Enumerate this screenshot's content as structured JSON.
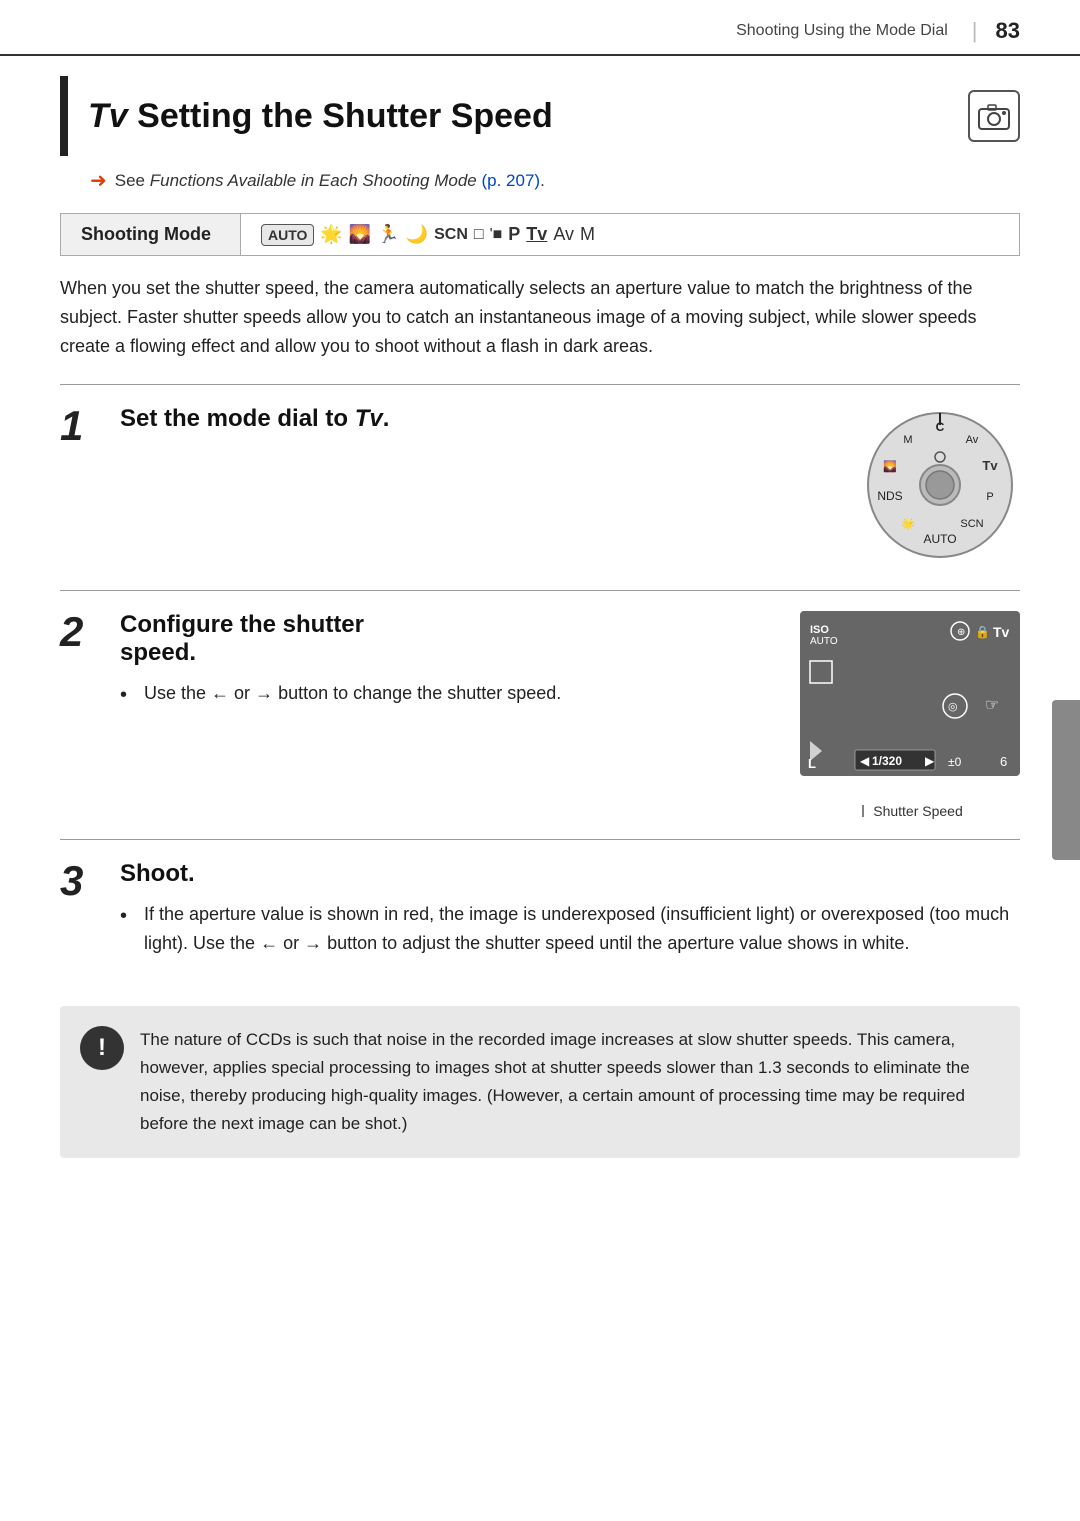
{
  "header": {
    "chapter_title": "Shooting Using the Mode Dial",
    "page_number": "83"
  },
  "title": {
    "prefix": "Tv",
    "main": "Setting the Shutter Speed",
    "camera_icon": "📷"
  },
  "see_ref": {
    "arrow": "➜",
    "text_before": "See ",
    "italic_text": "Functions Available in Each Shooting Mode",
    "text_after": " (p. 207)."
  },
  "shooting_mode": {
    "label": "Shooting Mode",
    "modes_text": "AUTO 🌟 🌄 🏃 SCN □ '■ P Tv Av M"
  },
  "intro": {
    "text": "When you set the shutter speed, the camera automatically selects an aperture value to match the brightness of the subject. Faster shutter speeds allow you to catch an instantaneous image of a moving subject, while slower speeds create a flowing effect and allow you to shoot without a flash in dark areas."
  },
  "steps": [
    {
      "number": "1",
      "title_parts": [
        "Set the mode dial to ",
        "Tv",
        "."
      ],
      "has_image": true,
      "image_type": "mode_dial"
    },
    {
      "number": "2",
      "title": "Configure the shutter speed.",
      "has_image": true,
      "image_type": "lcd",
      "bullets": [
        "Use the ← or → button to change the shutter speed."
      ],
      "lcd": {
        "top_left": "ISO AUTO",
        "top_right_icons": "⊕ 🔒 Tv",
        "shutter_speed": "1/320",
        "ev_comp": "±0",
        "bottom_right": "6",
        "shutter_speed_label": "Shutter Speed"
      }
    },
    {
      "number": "3",
      "title": "Shoot.",
      "bullets": [
        "If the aperture value is shown in red, the image is underexposed (insufficient light) or overexposed (too much light). Use the ← or → button to adjust the shutter speed until the aperture value shows in white."
      ]
    }
  ],
  "note": {
    "icon": "!",
    "text": "The nature of CCDs is such that noise in the recorded image increases at slow shutter speeds. This camera, however, applies special processing to images shot at shutter speeds slower than 1.3 seconds to eliminate the noise, thereby producing high-quality images. (However, a certain amount of processing time may be required before the next image can be shot.)"
  }
}
